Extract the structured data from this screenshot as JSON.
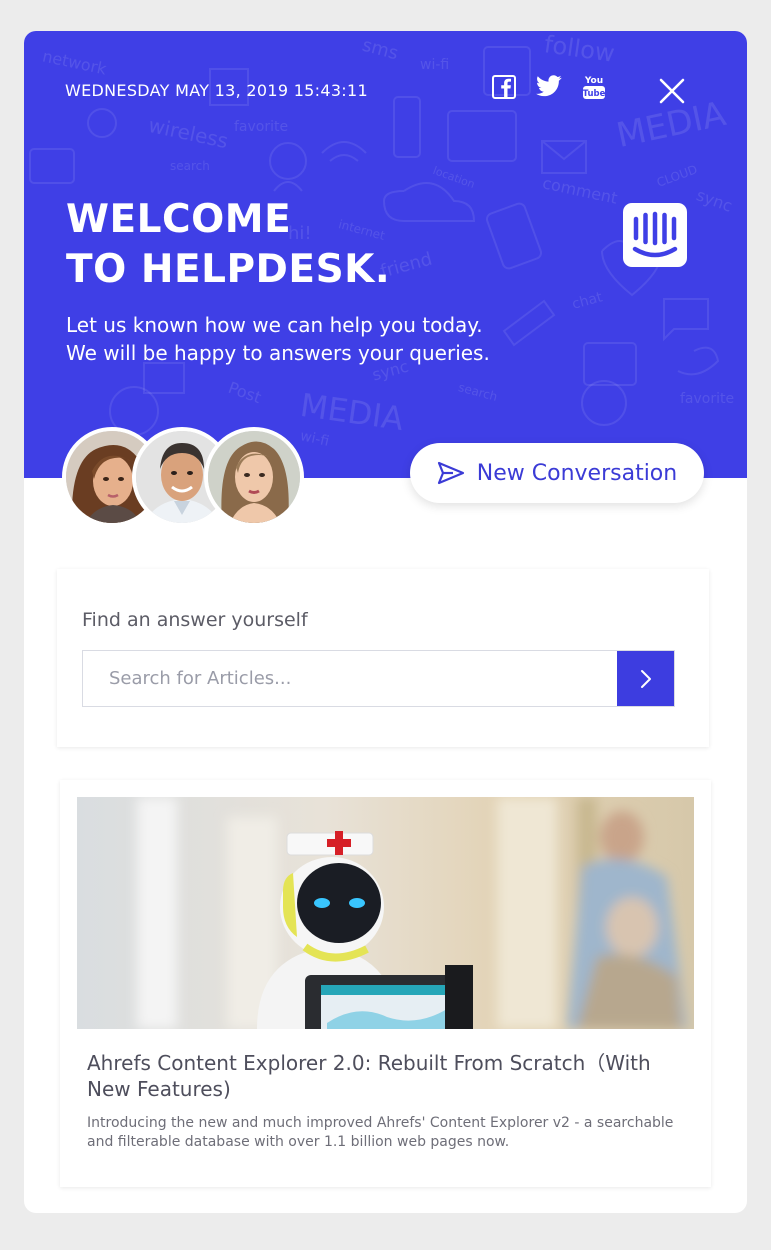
{
  "header": {
    "datetime": "WEDNESDAY MAY 13, 2019 15:43:11",
    "social": [
      {
        "name": "facebook-icon",
        "label": "f"
      },
      {
        "name": "twitter-icon",
        "label": "twitter"
      },
      {
        "name": "youtube-icon",
        "label": "You Tube"
      }
    ],
    "close_icon": "close-icon"
  },
  "hero": {
    "title_line1": "WELCOME",
    "title_line2": "TO HELPDESK.",
    "subtitle_line1": "Let us known how we can help you today.",
    "subtitle_line2": "We will be happy to answers your queries.",
    "pattern_words": [
      "network",
      "sms",
      "follow",
      "wi-fi",
      "wireless",
      "favorite",
      "search",
      "MEDIA",
      "comment",
      "location",
      "CLOUD",
      "sync",
      "hi!",
      "internet",
      "friend",
      "chat",
      "Post",
      "MEDIA",
      "wi-fi",
      "search",
      "favorite",
      "sync"
    ],
    "logo_icon": "intercom-logo-icon"
  },
  "agents": [
    {
      "name": "agent-avatar-1"
    },
    {
      "name": "agent-avatar-2"
    },
    {
      "name": "agent-avatar-3"
    }
  ],
  "new_conversation": {
    "label": "New Conversation",
    "icon": "send-icon"
  },
  "search": {
    "heading": "Find an answer yourself",
    "placeholder": "Search for Articles...",
    "button_icon": "chevron-right-icon"
  },
  "article": {
    "title": "Ahrefs Content Explorer 2.0: Rebuilt From Scratch（With New Features)",
    "excerpt": "Introducing the new and much improved Ahrefs' Content Explorer v2 - a searchable and filterable database with over 1.1 billion web pages now.",
    "image": "robot-nurse-image"
  },
  "colors": {
    "brand": "#3f3fe6",
    "accent": "#3d3de0",
    "background": "#ececec",
    "card": "#ffffff"
  }
}
